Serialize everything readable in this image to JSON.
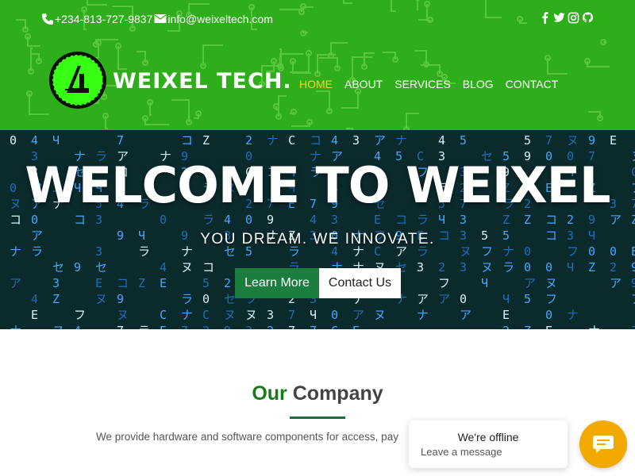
{
  "topbar": {
    "phone": "+234-813-727-9837",
    "email": "info@weixeltech.com",
    "social_icons": [
      "facebook-icon",
      "twitter-icon",
      "instagram-icon",
      "github-icon"
    ]
  },
  "brand": {
    "name": "WEIXEL TECH."
  },
  "nav": {
    "items": [
      "HOME",
      "ABOUT",
      "SERVICES",
      "BLOG",
      "CONTACT"
    ],
    "active": "HOME"
  },
  "hero": {
    "title": "WELCOME TO WEIXEL",
    "subtitle": "YOU DREAM. WE INNOVATE.",
    "primary_button": "Learn More",
    "secondary_button": "Contact Us"
  },
  "company": {
    "title_accent": "Our",
    "title_rest": "Company",
    "text": "We provide hardware and software components for access, pay"
  },
  "chat": {
    "status": "We're offline",
    "prompt": "Leave a message"
  },
  "colors": {
    "header_green": "#2fae1b",
    "nav_active": "#f5d21a",
    "button_green": "#1c7e3e",
    "title_green": "#1a7a1a",
    "chat_orange": "#f2a900"
  }
}
